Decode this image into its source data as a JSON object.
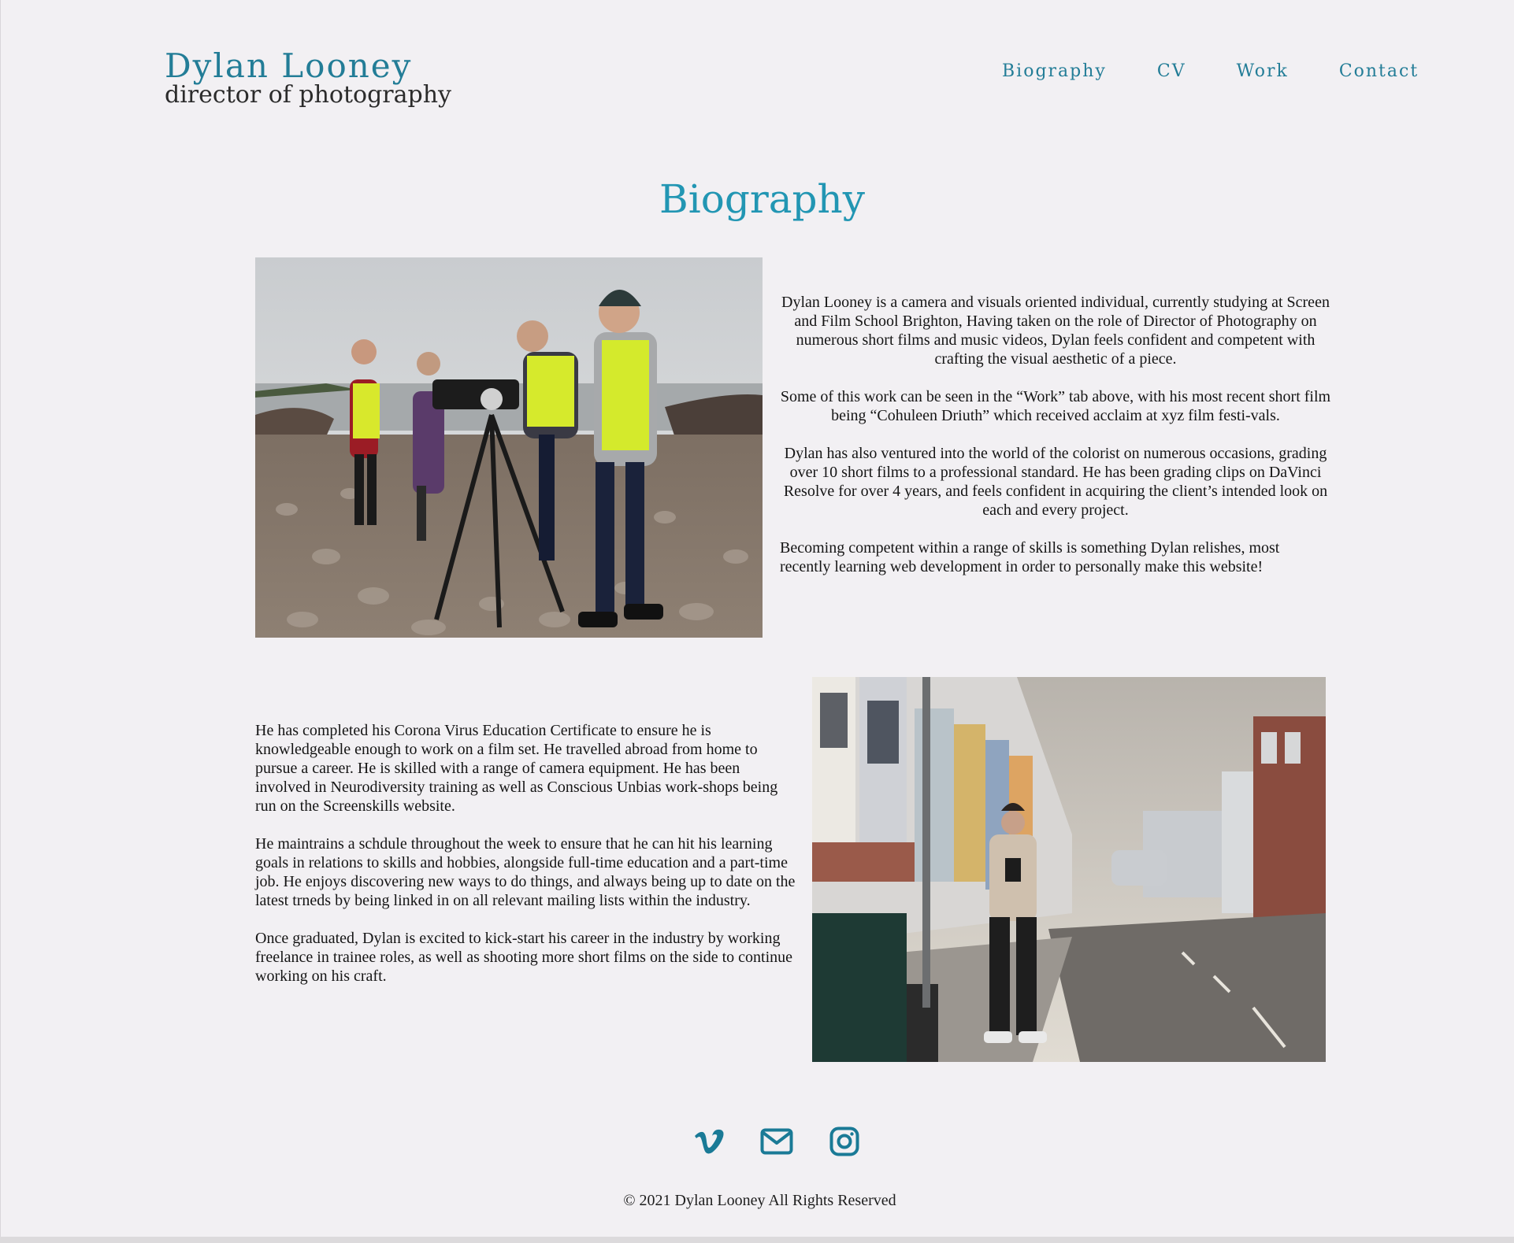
{
  "header": {
    "name": "Dylan Looney",
    "tagline": "director of photography",
    "nav": [
      "Biography",
      "CV",
      "Work",
      "Contact"
    ]
  },
  "main": {
    "title": "Biography",
    "bio_right": [
      "Dylan Looney is a camera and visuals oriented individual, currently studying at Screen and Film School Brighton, Having taken on the role of Director of Photography on numerous short films and music videos, Dylan feels confident and competent with crafting the visual aesthetic of a piece.",
      "Some of this work can be seen in the “Work” tab above, with his most recent short film being “Cohuleen Driuth”  which received acclaim at xyz film festi-vals.",
      "Dylan has also ventured into the world of the colorist on numerous occasions, grading over 10 short films to a professional standard. He has been grading clips on DaVinci Resolve for over 4 years, and feels confident in acquiring the client’s intended look on each and every project.",
      "Becoming competent within a range of skills is something Dylan relishes, most recently learning web development in order to personally make this website!"
    ],
    "bio_left": [
      "He has completed his Corona Virus Education Certificate to ensure he is knowledgeable enough to work on a film set. He travelled abroad from home to pursue a career. He is skilled with a range of camera equipment. He has been involved in Neurodiversity training as well as Conscious Unbias work-shops being run on the Screenskills website.",
      "He maintrains a schdule throughout the week to ensure that he can hit his learning goals in relations to skills and hobbies, alongside full-time education and a part-time job. He enjoys discovering new ways to do things, and always being up to date on the latest trneds by being linked in on all relevant mailing lists within the industry.",
      "Once graduated, Dylan is excited to kick-start his career in the industry by working freelance in trainee roles, as well as shooting more short films on the side to continue working on his craft."
    ],
    "images": {
      "photo1_icon": "film-crew-beach-photo",
      "photo2_icon": "street-portrait-photo"
    }
  },
  "footer": {
    "social_icons": [
      "vimeo-icon",
      "mail-icon",
      "instagram-icon"
    ],
    "copyright": "© 2021 Dylan Looney All Rights Reserved"
  },
  "colors": {
    "accent": "#237d97",
    "title": "#2296b3",
    "background": "#f2f0f3",
    "text": "#151515"
  }
}
